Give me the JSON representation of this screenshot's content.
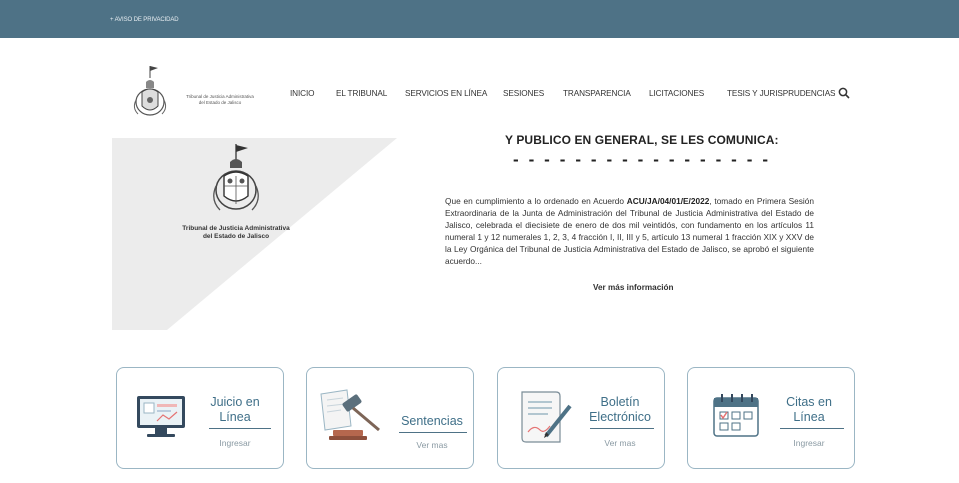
{
  "topbar": {
    "privacy_link": "+ AVISO DE PRIVACIDAD"
  },
  "logo": {
    "text_line1": "Tribunal de Justicia Administrativa",
    "text_line2": "del Estado de Jalisco"
  },
  "nav": {
    "items": [
      "INICIO",
      "EL TRIBUNAL",
      "SERVICIOS EN LÍNEA",
      "SESIONES",
      "TRANSPARENCIA",
      "LICITACIONES",
      "TESIS Y JURISPRUDENCIAS"
    ]
  },
  "hero": {
    "seal_line1": "Tribunal de Justicia Administrativa",
    "seal_line2": "del Estado de Jalisco",
    "title": "Y PUBLICO EN GENERAL, SE LES COMUNICA:",
    "dashes": "- - - - - - - - - - - - - - - - -",
    "para_a": "Que en cumplimiento a lo ordenado en Acuerdo ",
    "para_bold": "ACU/JA/04/01/E/2022",
    "para_b": ", tomado en Primera Sesión Extraordinaria de la Junta de Administración del Tribunal de Justicia Administrativa del Estado de Jalisco, celebrada el diecisiete de enero de dos mil veintidós, con fundamento en los artículos 11 numeral 1 y 12 numerales 1, 2, 3, 4 fracción I, II, III y 5, artículo 13 numeral 1 fracción XIX y XXV de la Ley Orgánica del Tribunal de Justicia Administrativa del Estado de Jalisco, se aprobó el siguiente acuerdo...",
    "more_link": "Ver más información"
  },
  "cards": [
    {
      "title1": "Juicio en",
      "title2": "Línea",
      "link": "Ingresar"
    },
    {
      "title1": "Sentencias",
      "title2": "",
      "link": "Ver mas"
    },
    {
      "title1": "Boletín",
      "title2": "Electrónico",
      "link": "Ver mas"
    },
    {
      "title1": "Citas en",
      "title2": "Línea",
      "link": "Ingresar"
    }
  ],
  "colors": {
    "topbar": "#4e7286",
    "accent": "#3f6f88",
    "card_border": "#9bb6c4"
  },
  "icons": [
    "search-icon",
    "seal-logo",
    "computer-icon",
    "gavel-icon",
    "document-pen-icon",
    "calendar-icon"
  ]
}
